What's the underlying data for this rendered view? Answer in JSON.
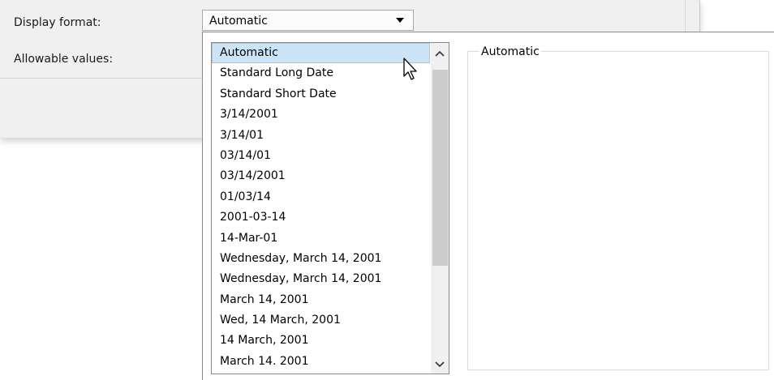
{
  "dialog": {
    "display_format_label": "Display format:",
    "allowable_values_label": "Allowable values:"
  },
  "combo": {
    "value": "Automatic",
    "arrow_icon": "chevron-down-icon"
  },
  "dropdown": {
    "items": [
      {
        "label": "Automatic",
        "selected": true
      },
      {
        "label": "Standard Long Date"
      },
      {
        "label": "Standard Short Date"
      },
      {
        "label": "3/14/2001"
      },
      {
        "label": "3/14/01"
      },
      {
        "label": "03/14/01"
      },
      {
        "label": "03/14/2001"
      },
      {
        "label": "01/03/14"
      },
      {
        "label": "2001-03-14"
      },
      {
        "label": "14-Mar-01"
      },
      {
        "label": "Wednesday, March 14, 2001"
      },
      {
        "label": "Wednesday, March 14, 2001"
      },
      {
        "label": "March 14, 2001"
      },
      {
        "label": "Wed, 14 March, 2001"
      },
      {
        "label": "14 March, 2001"
      },
      {
        "label": "March 14. 2001"
      }
    ],
    "scroll_up_icon": "chevron-up-icon",
    "scroll_down_icon": "chevron-down-icon"
  },
  "preview": {
    "title": "Automatic"
  },
  "colors": {
    "selection_bg": "#cce4f7",
    "selection_border": "#99c9ef",
    "dialog_bg": "#f0f0f0"
  }
}
